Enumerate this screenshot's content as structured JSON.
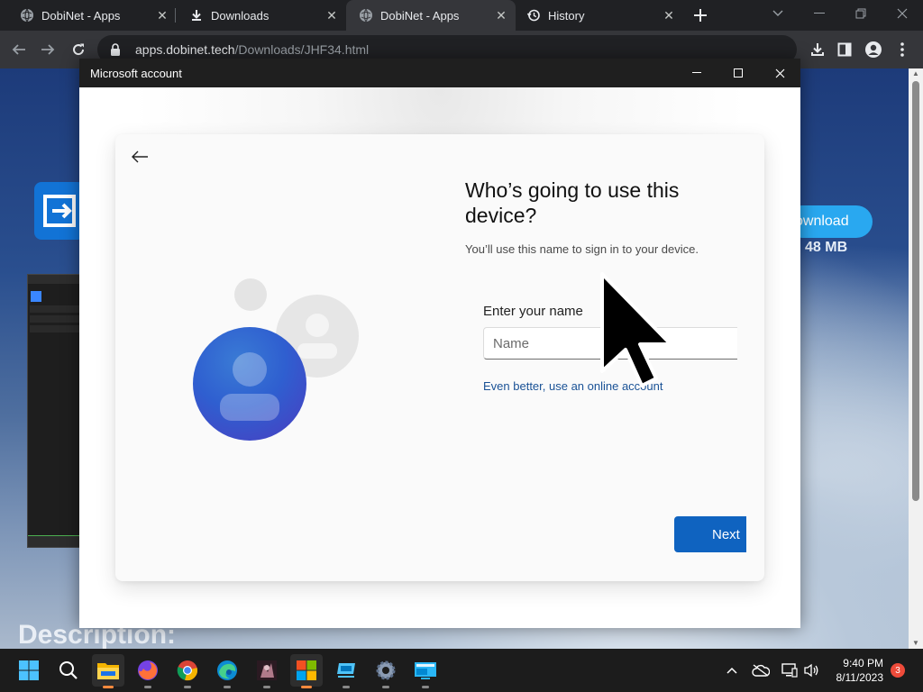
{
  "browser": {
    "tabs": [
      {
        "title": "DobiNet - Apps",
        "icon": "globe-icon"
      },
      {
        "title": "Downloads",
        "icon": "download-icon"
      },
      {
        "title": "DobiNet - Apps",
        "icon": "globe-icon"
      },
      {
        "title": "History",
        "icon": "history-icon"
      }
    ],
    "url_host": "apps.dobinet.tech",
    "url_path": "/Downloads/JHF34.html"
  },
  "page": {
    "download_button": "ownload",
    "download_size": "48 MB",
    "description_heading": "Description:"
  },
  "ms_window": {
    "title": "Microsoft account",
    "heading": "Who’s going to use this device?",
    "subtext": "You’ll use this name to sign in to your device.",
    "name_label": "Enter your name",
    "name_placeholder": "Name",
    "name_value": "",
    "online_link": "Even better, use an online account",
    "next_button": "Next"
  },
  "taskbar": {
    "apps": [
      "start-icon",
      "search-icon",
      "file-explorer-icon",
      "firefox-icon",
      "chrome-icon",
      "edge-icon",
      "game-icon",
      "microsoft-store-icon",
      "monitor-app-icon",
      "settings-icon",
      "remote-desktop-icon"
    ],
    "time": "9:40 PM",
    "date": "8/11/2023",
    "notifications": "3"
  },
  "colors": {
    "accent": "#0f63c0",
    "link": "#1a5296",
    "download_button": "#29a8f0",
    "notification_badge": "#ee4b3a"
  }
}
